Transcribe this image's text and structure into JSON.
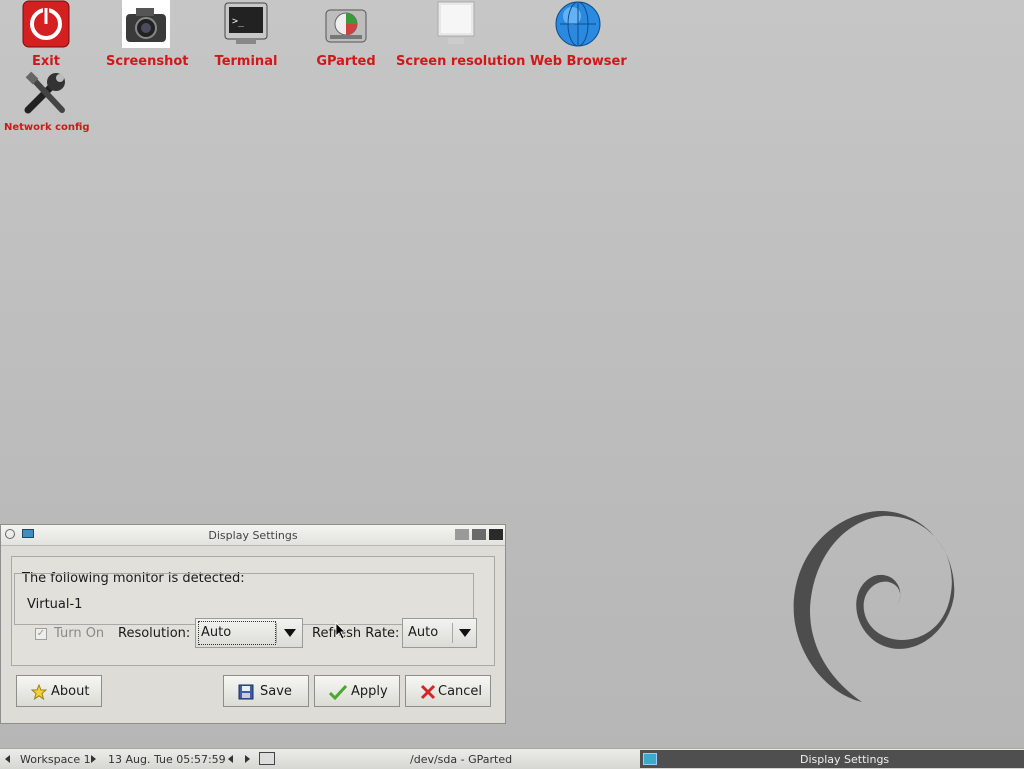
{
  "desktop": {
    "icons": [
      {
        "label": "Exit",
        "icon": "power-icon"
      },
      {
        "label": "Screenshot",
        "icon": "camera-icon"
      },
      {
        "label": "Terminal",
        "icon": "terminal-icon"
      },
      {
        "label": "GParted",
        "icon": "disk-icon"
      },
      {
        "label": "Screen resolution",
        "icon": "monitor-icon"
      },
      {
        "label": "Web Browser",
        "icon": "globe-icon"
      },
      {
        "label": "Network config",
        "icon": "tools-icon"
      }
    ],
    "label_color": "#d01818"
  },
  "window": {
    "title": "Display Settings",
    "detected_text": "The following monitor is detected:",
    "monitor_name": "Virtual-1",
    "turn_on_label": "Turn On",
    "turn_on_checked": true,
    "resolution_label": "Resolution:",
    "resolution_value": "Auto",
    "refresh_label": "Refresh Rate:",
    "refresh_value": "Auto",
    "buttons": {
      "about": "About",
      "save": "Save",
      "apply": "Apply",
      "cancel": "Cancel"
    }
  },
  "taskbar": {
    "workspace": "Workspace 1",
    "datetime": "13 Aug. Tue 05:57:59",
    "tasks": [
      "/dev/sda - GParted",
      "Display Settings"
    ]
  }
}
